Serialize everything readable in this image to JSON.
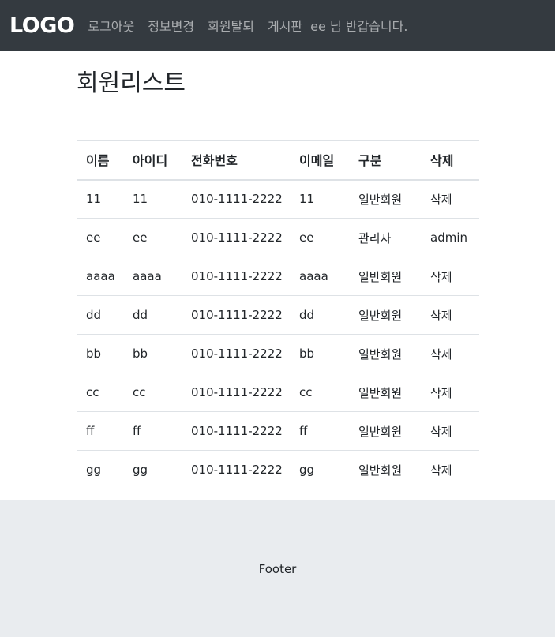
{
  "navbar": {
    "logo": "LOGO",
    "links": [
      "로그아웃",
      "정보변경",
      "회원탈퇴",
      "게시판"
    ],
    "greeting": "ee 님 반갑습니다."
  },
  "main": {
    "title": "회원리스트",
    "table": {
      "headers": [
        "이름",
        "아이디",
        "전화번호",
        "이메일",
        "구분",
        "삭제"
      ],
      "rows": [
        [
          "11",
          "11",
          "010-1111-2222",
          "11",
          "일반회원",
          "삭제"
        ],
        [
          "ee",
          "ee",
          "010-1111-2222",
          "ee",
          "관리자",
          "admin"
        ],
        [
          "aaaa",
          "aaaa",
          "010-1111-2222",
          "aaaa",
          "일반회원",
          "삭제"
        ],
        [
          "dd",
          "dd",
          "010-1111-2222",
          "dd",
          "일반회원",
          "삭제"
        ],
        [
          "bb",
          "bb",
          "010-1111-2222",
          "bb",
          "일반회원",
          "삭제"
        ],
        [
          "cc",
          "cc",
          "010-1111-2222",
          "cc",
          "일반회원",
          "삭제"
        ],
        [
          "ff",
          "ff",
          "010-1111-2222",
          "ff",
          "일반회원",
          "삭제"
        ],
        [
          "gg",
          "gg",
          "010-1111-2222",
          "gg",
          "일반회원",
          "삭제"
        ]
      ]
    }
  },
  "footer": {
    "text": "Footer"
  },
  "colors": {
    "navbar_bg": "#343a40",
    "footer_bg": "#e9ecef",
    "border": "#dee2e6"
  }
}
